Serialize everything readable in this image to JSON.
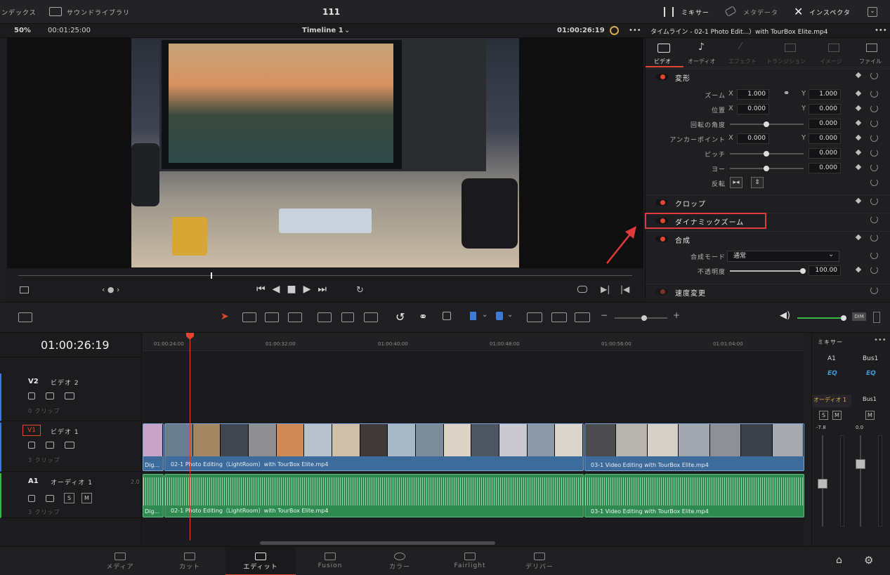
{
  "topbar": {
    "media_label": "ンデックス",
    "sound_library": "サウンドライブラリ",
    "project_title": "111",
    "mixer": "ミキサー",
    "metadata": "メタデータ",
    "inspector": "インスペクタ"
  },
  "viewer_bar": {
    "zoom": "50%",
    "duration": "00:01:25:00",
    "timeline_name": "Timeline 1",
    "timecode": "01:00:26:19"
  },
  "inspector": {
    "title": "タイムライン - 02-1 Photo Edit...）with TourBox Elite.mp4",
    "tabs": [
      "ビデオ",
      "オーディオ",
      "エフェクト",
      "トランジション",
      "イメージ",
      "ファイル"
    ],
    "sections": {
      "transform": "変形",
      "crop": "クロップ",
      "dynamic_zoom": "ダイナミックズーム",
      "composite": "合成",
      "speed": "速度変更"
    },
    "rows": {
      "zoom": {
        "label": "ズーム",
        "x": "1.000",
        "y": "1.000"
      },
      "position": {
        "label": "位置",
        "x": "0.000",
        "y": "0.000"
      },
      "rotation": {
        "label": "回転の角度",
        "value": "0.000"
      },
      "anchor": {
        "label": "アンカーポイント",
        "x": "0.000",
        "y": "0.000"
      },
      "pitch": {
        "label": "ピッチ",
        "value": "0.000"
      },
      "yaw": {
        "label": "ヨー",
        "value": "0.000"
      },
      "flip": {
        "label": "反転"
      },
      "blend_mode": {
        "label": "合成モード",
        "value": "通常"
      },
      "opacity": {
        "label": "不透明度",
        "value": "100.00"
      }
    },
    "axis_x": "X",
    "axis_y": "Y"
  },
  "timeline": {
    "timecode": "01:00:26:19",
    "ruler": [
      "01:00:24:00",
      "01:00:32:00",
      "01:00:40:00",
      "01:00:48:00",
      "01:00:56:00",
      "01:01:04:00"
    ],
    "tracks": [
      {
        "id": "V2",
        "name": "ビデオ 2",
        "clips": "0 クリップ"
      },
      {
        "id": "V1",
        "name": "ビデオ 1",
        "clips": "3 クリップ"
      },
      {
        "id": "A1",
        "name": "オーディオ 1",
        "clips": "3 クリップ",
        "level": "2.0"
      }
    ],
    "clip_v_prev": "Dig...",
    "clip_v1": "02-1 Photo Editing（LightRoom）with TourBox Elite.mp4",
    "clip_v2": "03-1 Video Editing with TourBox Elite.mp4",
    "clip_a_prev": "Dig...",
    "clip_a1": "02-1 Photo Editing（LightRoom）with TourBox Elite.mp4",
    "clip_a2": "03-1 Video Editing with TourBox Elite.mp4"
  },
  "mixer": {
    "title": "ミキサー",
    "ch1": "A1",
    "ch2": "Bus1",
    "eq": "EQ",
    "ch1_name": "オーディオ 1",
    "ch2_name": "Bus1",
    "ch1_level": "-7.8",
    "ch2_level": "0.0",
    "s": "S",
    "m": "M",
    "dim": "DIM"
  },
  "pages": [
    "メディア",
    "カット",
    "エディット",
    "Fusion",
    "カラー",
    "Fairlight",
    "デリバー"
  ]
}
